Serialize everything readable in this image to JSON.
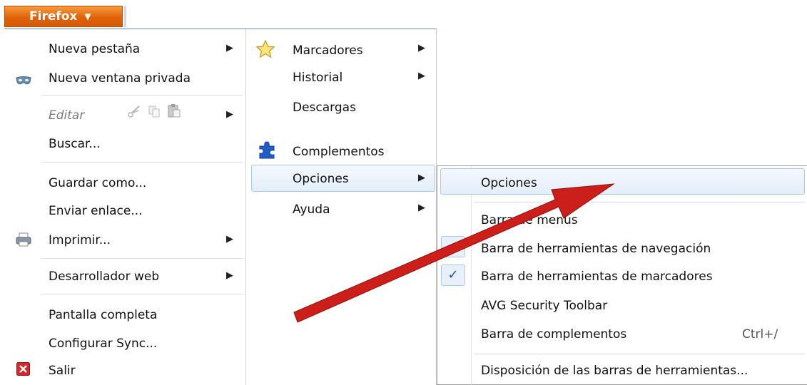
{
  "firefox_button": {
    "label": "Firefox",
    "arrow": "▼"
  },
  "left_menu": [
    {
      "label": "Nueva pestaña",
      "submenu": true
    },
    {
      "label": "Nueva ventana privada",
      "icon": "private-mask-icon"
    },
    {
      "label": "Editar",
      "disabled": true,
      "submenu": true,
      "icons": [
        "cut-icon",
        "copy-icon",
        "paste-icon"
      ]
    },
    {
      "label": "Buscar..."
    },
    {
      "label": "Guardar como..."
    },
    {
      "label": "Enviar enlace..."
    },
    {
      "label": "Imprimir...",
      "submenu": true,
      "icon": "printer-icon"
    },
    {
      "label": "Desarrollador web",
      "submenu": true
    },
    {
      "label": "Pantalla completa"
    },
    {
      "label": "Configurar Sync..."
    },
    {
      "label": "Salir",
      "icon": "exit-icon"
    }
  ],
  "right_menu": [
    {
      "label": "Marcadores",
      "submenu": true,
      "icon": "star-icon"
    },
    {
      "label": "Historial",
      "submenu": true
    },
    {
      "label": "Descargas"
    },
    {
      "label": "Complementos",
      "icon": "puzzle-icon"
    },
    {
      "label": "Opciones",
      "submenu": true,
      "highlighted": true
    },
    {
      "label": "Ayuda",
      "submenu": true
    }
  ],
  "options_submenu": [
    {
      "label": "Opciones",
      "highlighted": true
    },
    {
      "label": "Barra de menús",
      "checked": false
    },
    {
      "label": "Barra de herramientas de navegación",
      "checked": true
    },
    {
      "label": "Barra de herramientas de marcadores",
      "checked": true
    },
    {
      "label": "AVG Security Toolbar",
      "checked": false
    },
    {
      "label": "Barra de complementos",
      "shortcut": "Ctrl+/",
      "checked": false
    },
    {
      "label": "Disposición de las barras de herramientas..."
    }
  ],
  "colors": {
    "firefox_orange": "#e0630a",
    "highlight_border": "#a8c8ec",
    "arrow_red": "#cc1f1a",
    "check_blue": "#1a4fb0"
  }
}
